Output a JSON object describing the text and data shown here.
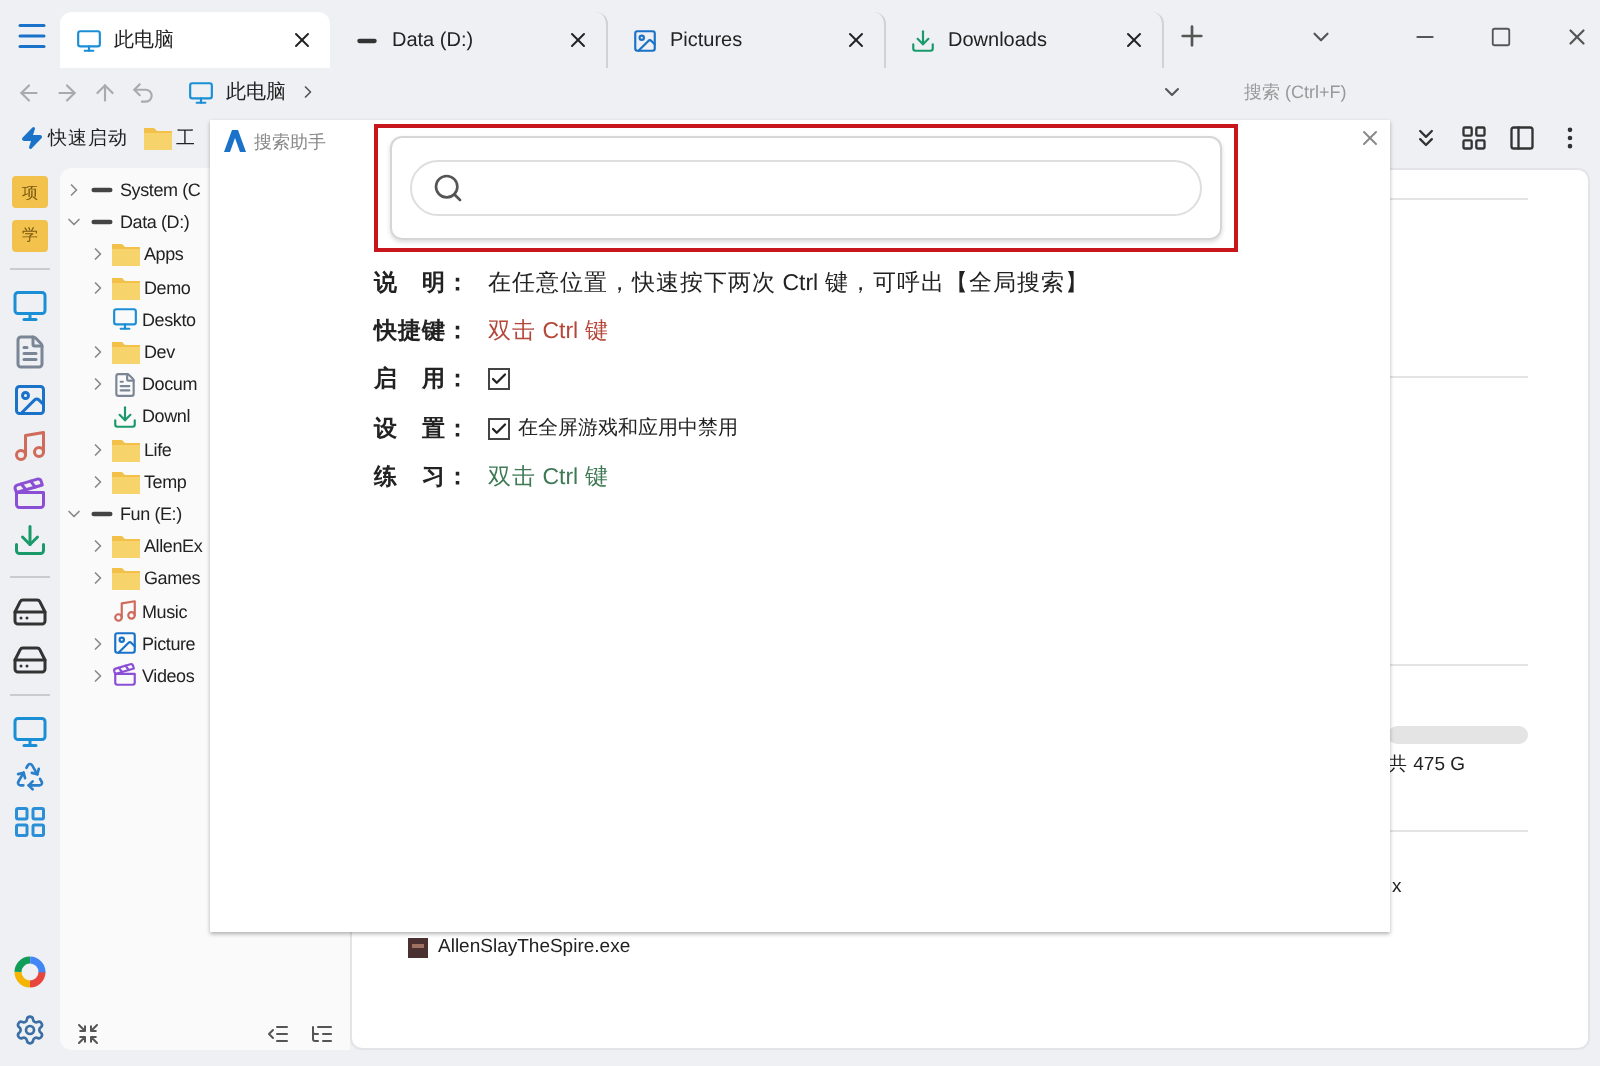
{
  "tabs": [
    {
      "label": "此电脑",
      "kind": "monitor",
      "selected": true
    },
    {
      "label": "Data (D:)",
      "kind": "drive",
      "selected": false
    },
    {
      "label": "Pictures",
      "kind": "picture",
      "selected": false
    },
    {
      "label": "Downloads",
      "kind": "download",
      "selected": false
    }
  ],
  "address": {
    "crumbs": [
      "此电脑"
    ],
    "search_placeholder": "搜索 (Ctrl+F)"
  },
  "toolbar": {
    "items": [
      {
        "label": "快速启动",
        "kind": "bolt"
      },
      {
        "label": "工",
        "kind": "folder"
      }
    ]
  },
  "rail": [
    {
      "kind": "folder",
      "label": "项"
    },
    {
      "kind": "folder",
      "label": "学"
    },
    {
      "kind": "divider"
    },
    {
      "kind": "desktop"
    },
    {
      "kind": "document"
    },
    {
      "kind": "picture"
    },
    {
      "kind": "music"
    },
    {
      "kind": "video"
    },
    {
      "kind": "download"
    },
    {
      "kind": "divider"
    },
    {
      "kind": "drive"
    },
    {
      "kind": "drive"
    },
    {
      "kind": "divider"
    },
    {
      "kind": "monitor"
    },
    {
      "kind": "recycle"
    },
    {
      "kind": "control"
    }
  ],
  "tree": [
    {
      "label": "System (C",
      "kind": "drive",
      "expanded": false
    },
    {
      "label": "Data (D:)",
      "kind": "drive",
      "expanded": true,
      "children": [
        {
          "label": "Apps",
          "kind": "folder",
          "expanded": false
        },
        {
          "label": "Demo",
          "kind": "folder",
          "expanded": false
        },
        {
          "label": "Deskto",
          "kind": "desktop"
        },
        {
          "label": "Dev",
          "kind": "folder",
          "expanded": false
        },
        {
          "label": "Docum",
          "kind": "document",
          "expanded": false
        },
        {
          "label": "Downl",
          "kind": "download"
        },
        {
          "label": "Life",
          "kind": "folder",
          "expanded": false
        },
        {
          "label": "Temp",
          "kind": "folder",
          "expanded": false
        }
      ]
    },
    {
      "label": "Fun (E:)",
      "kind": "drive",
      "expanded": true,
      "children": [
        {
          "label": "AllenEx",
          "kind": "folder",
          "expanded": false
        },
        {
          "label": "Games",
          "kind": "folder",
          "expanded": false
        },
        {
          "label": "Music",
          "kind": "music"
        },
        {
          "label": "Picture",
          "kind": "picture",
          "expanded": false
        },
        {
          "label": "Videos",
          "kind": "video",
          "expanded": false
        }
      ]
    }
  ],
  "content": {
    "capacity": "共 475 G",
    "file_tail": "x",
    "files": [
      {
        "name": "AllenSlayTheSpire.exe"
      }
    ]
  },
  "dialog": {
    "title": "搜索助手",
    "search_highlighted": true,
    "rows": [
      {
        "label": "说　明：",
        "kind": "text",
        "value": "在任意位置，快速按下两次 Ctrl 键，可呼出【全局搜索】"
      },
      {
        "label": "快捷键：",
        "kind": "text",
        "value": "双击 Ctrl 键",
        "color": "#b5473a"
      },
      {
        "label": "启　用：",
        "kind": "checkbox",
        "checked": true
      },
      {
        "label": "设　置：",
        "kind": "checkbox",
        "checked": true,
        "value": "在全屏游戏和应用中禁用"
      },
      {
        "label": "练　习：",
        "kind": "text",
        "value": "双击 Ctrl 键",
        "color": "#3f7a55"
      }
    ]
  }
}
